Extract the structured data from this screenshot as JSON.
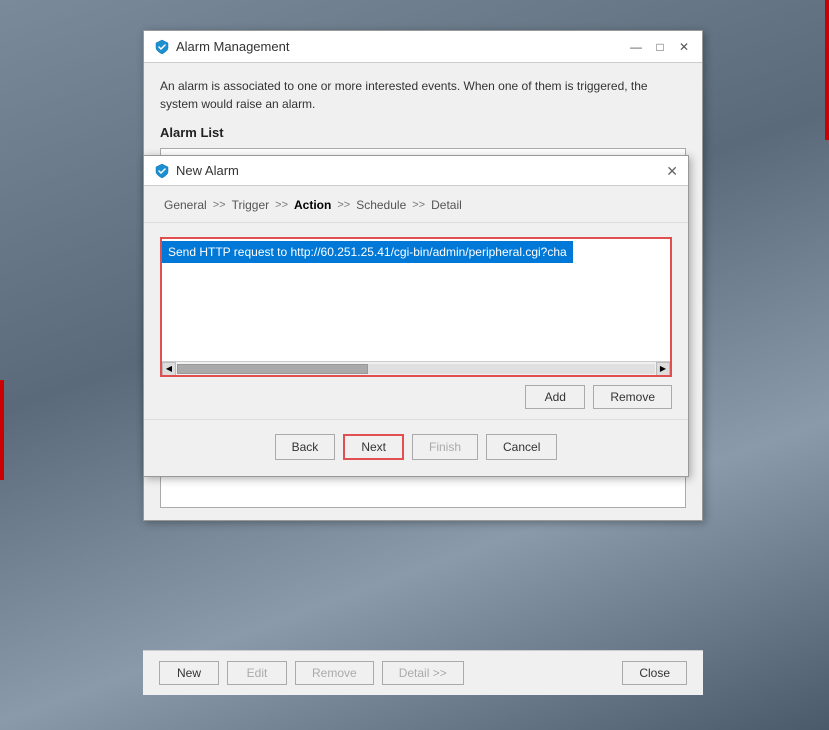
{
  "background": {
    "color": "#6a7a8a"
  },
  "alarmMgmtWindow": {
    "title": "Alarm Management",
    "description": "An alarm is associated to one or more interested events. When one of them is triggered, the system would raise an alarm.",
    "alarmListLabel": "Alarm List",
    "titlebarControls": {
      "minimize": "—",
      "restore": "□",
      "close": "✕"
    }
  },
  "newAlarmDialog": {
    "title": "New Alarm",
    "closeLabel": "✕",
    "steps": [
      {
        "id": "general",
        "label": "General",
        "active": false
      },
      {
        "id": "trigger",
        "label": "Trigger",
        "active": false
      },
      {
        "id": "action",
        "label": "Action",
        "active": true
      },
      {
        "id": "schedule",
        "label": "Schedule",
        "active": false
      },
      {
        "id": "detail",
        "label": "Detail",
        "active": false
      }
    ],
    "arrowLabel": ">>",
    "actionListItems": [
      "Send HTTP request to http://60.251.25.41/cgi-bin/admin/peripheral.cgi?cha"
    ],
    "buttons": {
      "add": "Add",
      "remove": "Remove"
    },
    "navButtons": {
      "back": "Back",
      "next": "Next",
      "finish": "Finish",
      "cancel": "Cancel"
    }
  },
  "bottomBar": {
    "new": "New",
    "edit": "Edit",
    "remove": "Remove",
    "detail": "Detail >>",
    "close": "Close"
  }
}
